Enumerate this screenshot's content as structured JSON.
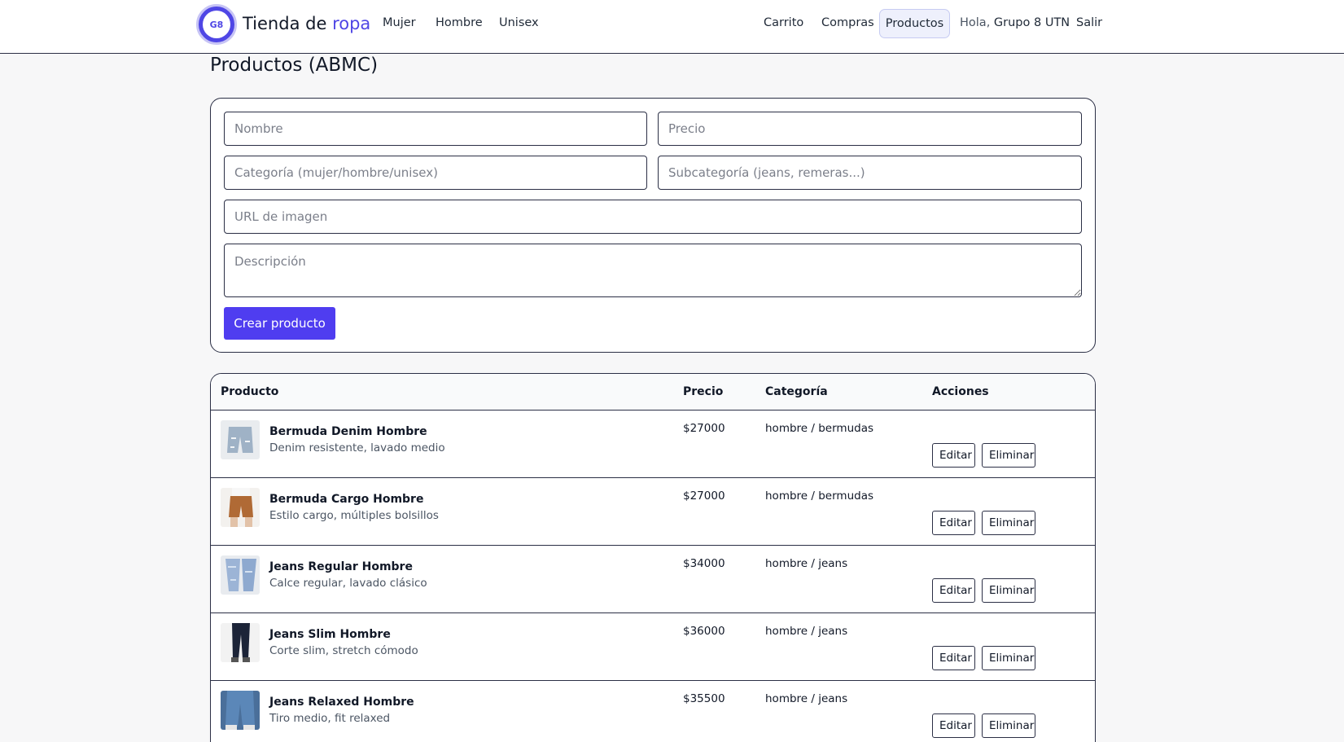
{
  "nav": {
    "logo_text": "G8",
    "brand_main": "Tienda de",
    "brand_accent": "ropa",
    "left_links": [
      "Mujer",
      "Hombre",
      "Unisex"
    ],
    "cart": "Carrito",
    "purchases": "Compras",
    "products": "Productos",
    "greeting_prefix": "Hola,",
    "user_name": "Grupo 8 UTN",
    "logout": "Salir"
  },
  "page_title": "Productos (ABMC)",
  "form": {
    "name_placeholder": "Nombre",
    "price_placeholder": "Precio",
    "category_placeholder": "Categoría (mujer/hombre/unisex)",
    "subcategory_placeholder": "Subcategoría (jeans, remeras...)",
    "image_url_placeholder": "URL de imagen",
    "description_placeholder": "Descripción",
    "submit_label": "Crear producto"
  },
  "table": {
    "headers": {
      "product": "Producto",
      "price": "Precio",
      "category": "Categoría",
      "actions": "Acciones"
    },
    "edit_label": "Editar",
    "delete_label": "Eliminar",
    "rows": [
      {
        "name": "Bermuda Denim Hombre",
        "desc": "Denim resistente, lavado medio",
        "price": "$27000",
        "category": "hombre / bermudas"
      },
      {
        "name": "Bermuda Cargo Hombre",
        "desc": "Estilo cargo, múltiples bolsillos",
        "price": "$27000",
        "category": "hombre / bermudas"
      },
      {
        "name": "Jeans Regular Hombre",
        "desc": "Calce regular, lavado clásico",
        "price": "$34000",
        "category": "hombre / jeans"
      },
      {
        "name": "Jeans Slim Hombre",
        "desc": "Corte slim, stretch cómodo",
        "price": "$36000",
        "category": "hombre / jeans"
      },
      {
        "name": "Jeans Relaxed Hombre",
        "desc": "Tiro medio, fit relaxed",
        "price": "$35500",
        "category": "hombre / jeans"
      }
    ]
  },
  "colors": {
    "accent": "#4f46e5",
    "button": "#4f3df0",
    "border": "#2b2f45",
    "background": "#f7f7f8"
  }
}
